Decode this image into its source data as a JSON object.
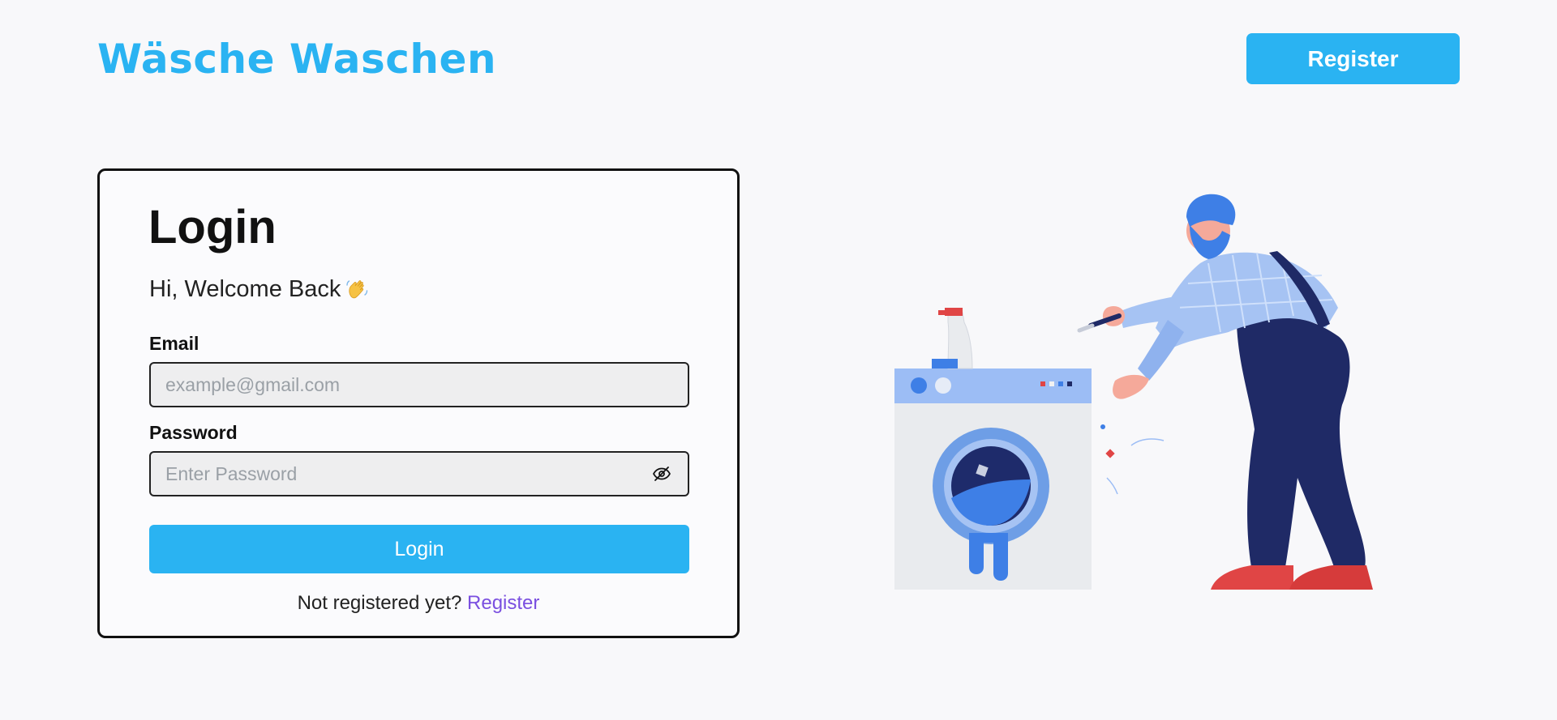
{
  "header": {
    "brand": "Wäsche Waschen",
    "register_label": "Register"
  },
  "login_card": {
    "title": "Login",
    "welcome": "Hi, Welcome Back",
    "email_label": "Email",
    "email_placeholder": "example@gmail.com",
    "email_value": "",
    "password_label": "Password",
    "password_placeholder": "Enter Password",
    "password_value": "",
    "password_toggle_icon": "eye-slash-icon",
    "submit_label": "Login",
    "footer_text": "Not registered yet?",
    "footer_link": "Register"
  },
  "illustration": {
    "icon": "laundry-repair-illustration"
  },
  "colors": {
    "accent": "#2ab3f2",
    "link": "#7a4fe0",
    "background": "#f8f8fa"
  }
}
